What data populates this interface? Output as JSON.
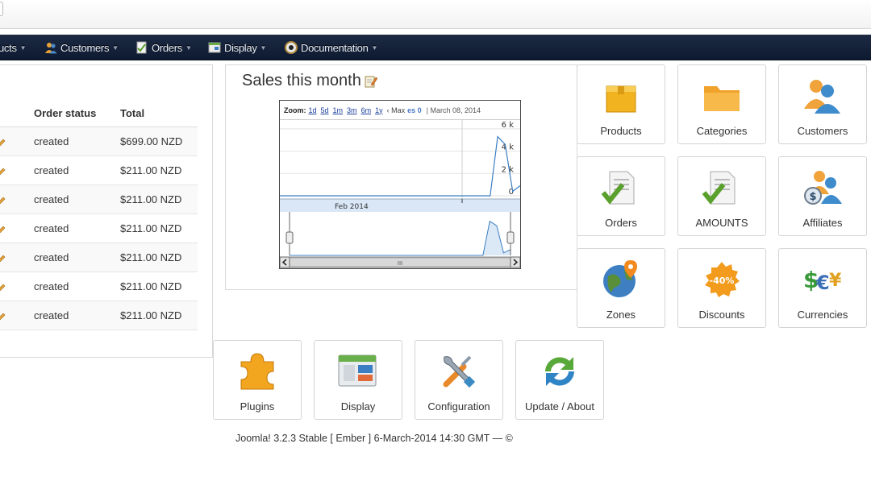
{
  "nav": {
    "items": [
      {
        "label": "ucts",
        "icon": "products-icon"
      },
      {
        "label": "Customers",
        "icon": "customers-icon"
      },
      {
        "label": "Orders",
        "icon": "orders-icon"
      },
      {
        "label": "Display",
        "icon": "display-icon"
      },
      {
        "label": "Documentation",
        "icon": "documentation-icon"
      }
    ]
  },
  "orders": {
    "headers": {
      "status": "Order status",
      "total": "Total"
    },
    "rows": [
      {
        "status": "created",
        "total": "$699.00 NZD"
      },
      {
        "status": "created",
        "total": "$211.00 NZD"
      },
      {
        "status": "created",
        "total": "$211.00 NZD"
      },
      {
        "status": "created",
        "total": "$211.00 NZD"
      },
      {
        "status": "created",
        "total": "$211.00 NZD"
      },
      {
        "status": "created",
        "total": "$211.00 NZD"
      },
      {
        "status": "created",
        "total": "$211.00 NZD"
      }
    ]
  },
  "sales": {
    "title": "Sales this month",
    "zoom_label": "Zoom:",
    "zoom_options": [
      "1d",
      "5d",
      "1m",
      "3m",
      "6m",
      "1y"
    ],
    "max_label": "‹ Max",
    "es_label": "es 0",
    "date_label": "| March 08, 2014",
    "navigator_label": "Feb 2014",
    "scrollbar_grip": "III"
  },
  "chart_data": {
    "type": "line",
    "yticks": [
      "6 k",
      "4 k",
      "2 k",
      "0"
    ],
    "ylim": [
      0,
      6500
    ],
    "x_label": "Feb 2014",
    "series": [
      {
        "values": [
          0,
          0,
          0,
          0,
          0,
          0,
          0,
          0,
          0,
          0,
          0,
          0,
          0,
          0,
          0,
          0,
          0,
          0,
          0,
          0,
          0,
          0,
          0,
          0,
          0,
          0,
          0,
          0,
          0,
          5300,
          4600,
          400,
          900
        ]
      }
    ]
  },
  "tiles": [
    {
      "label": "Products",
      "icon": "products-box-icon"
    },
    {
      "label": "Categories",
      "icon": "folder-icon"
    },
    {
      "label": "Customers",
      "icon": "customers-people-icon"
    },
    {
      "label": "Orders",
      "icon": "orders-check-icon"
    },
    {
      "label": "AMOUNTS",
      "icon": "amounts-check-icon"
    },
    {
      "label": "Affiliates",
      "icon": "affiliates-icon"
    },
    {
      "label": "Zones",
      "icon": "globe-icon"
    },
    {
      "label": "Discounts",
      "icon": "discount-badge-icon"
    },
    {
      "label": "Currencies",
      "icon": "currency-icon"
    },
    {
      "label": "Plugins",
      "icon": "puzzle-icon"
    },
    {
      "label": "Display",
      "icon": "display-window-icon"
    },
    {
      "label": "Configuration",
      "icon": "tools-icon"
    },
    {
      "label": "Update / About",
      "icon": "update-icon"
    }
  ],
  "footer": {
    "text": "Joomla! 3.2.3 Stable [ Ember ] 6-March-2014 14:30 GMT  —  ©"
  },
  "colors": {
    "nav_bg": "#15223a",
    "accent": "#4a79c7",
    "line": "#3b7fc4"
  }
}
